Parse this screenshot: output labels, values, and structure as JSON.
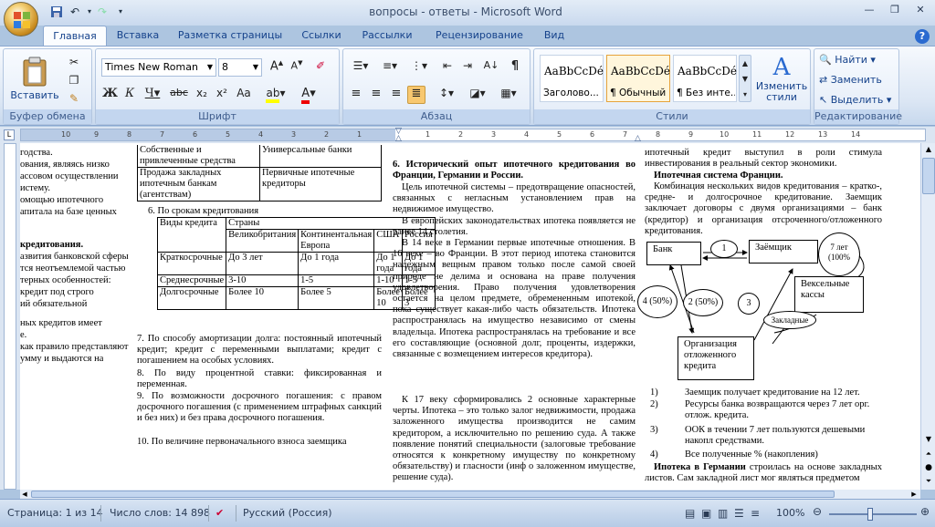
{
  "window": {
    "title": "вопросы - ответы - Microsoft Word"
  },
  "tabs": [
    "Главная",
    "Вставка",
    "Разметка страницы",
    "Ссылки",
    "Рассылки",
    "Рецензирование",
    "Вид"
  ],
  "ribbon": {
    "clipboard": {
      "paste": "Вставить",
      "label": "Буфер обмена"
    },
    "font": {
      "name": "Times New Roman",
      "size": "8",
      "label": "Шрифт"
    },
    "paragraph": {
      "label": "Абзац"
    },
    "styles": {
      "label": "Стили",
      "items": [
        {
          "sample": "AaBbCcDé",
          "name": "Заголово..."
        },
        {
          "sample": "AaBbCcDé",
          "name": "¶ Обычный"
        },
        {
          "sample": "AaBbCcDé",
          "name": "¶ Без инте..."
        }
      ],
      "change": "Изменить стили"
    },
    "editing": {
      "find": "Найти",
      "replace": "Заменить",
      "select": "Выделить",
      "label": "Редактирование"
    }
  },
  "ruler": {
    "left_numbers": [
      "10",
      "9",
      "8",
      "7",
      "6",
      "5",
      "4",
      "3",
      "2",
      "1"
    ],
    "right_numbers": [
      "1",
      "2",
      "3",
      "4",
      "5",
      "6",
      "7",
      "8",
      "9",
      "10",
      "11",
      "12",
      "13",
      "14"
    ]
  },
  "doc": {
    "col1": [
      "годства.",
      "ования, являясь низко",
      "ассовом осуществлении",
      "истему.",
      "омощью ипотечного",
      "апитала на базе ценных",
      "кредитования.",
      "азвития банковской сферы",
      "тся неотъемлемой частью",
      "терных особенностей:",
      "кредит под строго",
      "ий обязательной",
      "ных кредитов имеет",
      "е.",
      "как правило представляют",
      "умму и выдаются на"
    ],
    "table1": {
      "r1c1": "Собственные и привлеченные средства",
      "r1c2": "Универсальные банки",
      "r2c1": "Продажа закладных ипотечным банкам (агентствам)",
      "r2c2": "Первичные ипотечные кредиторы"
    },
    "item6": "6.        По срокам кредитования",
    "table2": {
      "h1": "Виды кредита",
      "h2": "Страны",
      "countries": [
        "Великобритания",
        "Континентальная Европа",
        "США",
        "Россия"
      ],
      "rows": [
        {
          "name": "Краткосрочные",
          "vals": [
            "До 3 лет",
            "До 1 года",
            "До 1 года",
            "До 1 года"
          ]
        },
        {
          "name": "Среднесрочные",
          "vals": [
            "3-10",
            "1-5",
            "1-10",
            "1-5"
          ]
        },
        {
          "name": "Долгосрочные",
          "vals": [
            "Более 10",
            "Более 5",
            "Более 10",
            "Более 3"
          ]
        }
      ]
    },
    "col2_after": [
      "7.        По способу амортизации долга: постоянный ипотечный кредит; кредит с переменными выплатами; кредит с погашением на особых условиях.",
      "8.        По виду процентной ставки: фиксированная и переменная.",
      "9.        По возможности досрочного погашения: с правом досрочного погашения (с применением штрафных санкций и без них) и без права досрочного погашения.",
      "10.       По величине первоначального взноса заемщика"
    ],
    "col3": {
      "heading": "6.    Исторический опыт ипотечного кредитования во Франции, Германии и России.",
      "p1": "Цель ипотечной системы – предотвращение опасностей, связанных с негласным установлением прав на недвижимое имущество.",
      "p2": "В европейских законодательствах ипотека появляется не ранее 14 столетия.",
      "p3": "В 14 веке в Германии первые ипотечные отношения. В 16 веке – во Франции. В этот период ипотека становится надежным вещным правом только после самой своей природе не делима и основана на праве получения удовлетворения. Право получения удовлетворения остается на целом предмете, обремененным ипотекой, пока существует какая-либо часть обязательств. Ипотека распространялась на имущество независимо от смены владельца. Ипотека распространялась на требование и все его составляющие (основной долг, проценты, издержки, связанные с возмещением интересов кредитора).",
      "p4": "К 17 веку сформировались 2 основные характерные черты. Ипотека – это только залог недвижимости, продажа заложенного имущества производится не самим кредитором, а исключительно по решению суда. А также появление понятий специальности (залоговые требование относятся к конкретному имуществу по конкретному обязательству) и гласности (инф о заложенном имуществе, решение суда)."
    },
    "col4": {
      "top": "ипотечный кредит выступил в роли стимула инвестирования в реальный сектор экономики.",
      "heading": "Ипотечная система Франции.",
      "p1": "Комбинация нескольких видов кредитования – кратко-, средне- и долгосрочное кредитование. Заемщик заключает договоры с двумя организациями – банк (кредитор) и организация отсроченного/отложенного кредитования.",
      "diagram": {
        "bank": "Банк",
        "borrower": "Заёмщик",
        "org": "Организация отложенного кредита",
        "kassy": "Вексельные кассы",
        "l1": "1",
        "l2": "2 (50%)",
        "l3": "3",
        "l4": "4 (50%)",
        "l7": "7 лет (100%",
        "zakl": "Закладные"
      },
      "list": [
        {
          "n": "1)",
          "t": "Заемщик получает кредитование на 12 лет."
        },
        {
          "n": "2)",
          "t": "Ресурсы банка возвращаются через 7 лет орг. отлож. кредита."
        },
        {
          "n": "3)",
          "t": "ООК в течении 7 лет пользуются дешевыми накопл средствами."
        },
        {
          "n": "4)",
          "t": "Все полученные % (накопления)"
        }
      ],
      "bottom_bold": "Ипотека в Германии",
      "bottom": " строилась на основе закладных листов. Сам закладной лист мог являться предметом"
    }
  },
  "status": {
    "page": "Страница: 1 из 14",
    "words": "Число слов: 14 898",
    "lang": "Русский (Россия)",
    "zoom": "100%"
  },
  "colors": {
    "ribbon_text": "#15428b",
    "accent": "#e6a33b"
  }
}
